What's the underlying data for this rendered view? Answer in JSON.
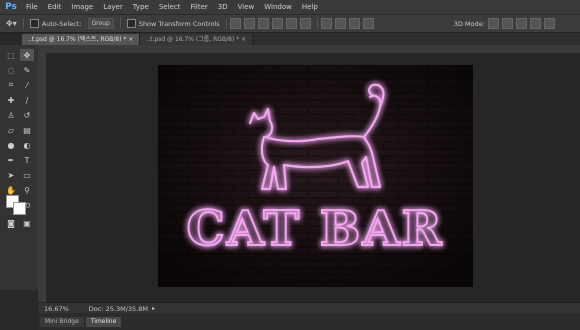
{
  "app": {
    "logo": "Ps"
  },
  "menu": [
    "File",
    "Edit",
    "Image",
    "Layer",
    "Type",
    "Select",
    "Filter",
    "3D",
    "View",
    "Window",
    "Help"
  ],
  "options": {
    "auto_select_label": "Auto-Select:",
    "auto_select_value": "Group",
    "show_transform_label": "Show Transform Controls",
    "mode_label": "3D Mode:"
  },
  "tabs": [
    {
      "label": "..t.psd @ 16.7% (텍스트, RGB/8) *",
      "active": true
    },
    {
      "label": "..t.psd @ 16.7% (그룹, RGB/8) *",
      "active": false
    }
  ],
  "canvas": {
    "line1": "CAT BAR",
    "neon_color": "#f2a6f0"
  },
  "status": {
    "zoom": "16.67%",
    "doc": "Doc: 25.3M/35.8M"
  },
  "panels": [
    {
      "label": "Mini Bridge",
      "active": false
    },
    {
      "label": "Timeline",
      "active": true
    }
  ],
  "colors": {
    "foreground": "#ffffff",
    "background": "#ffffff"
  }
}
